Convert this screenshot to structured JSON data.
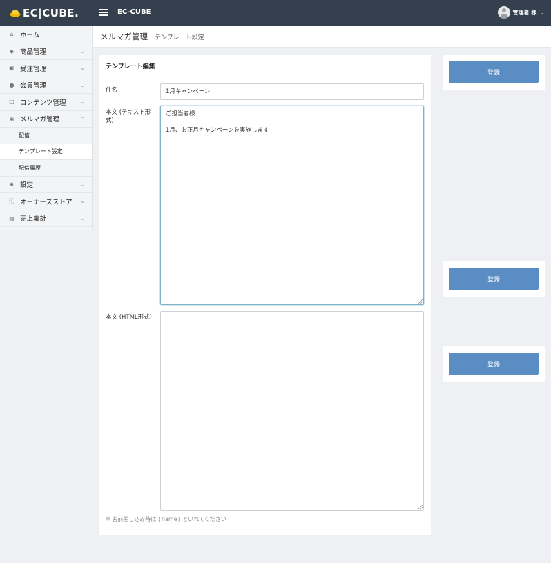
{
  "header": {
    "logo_text": "EC|CUBE.",
    "app_name": "EC-CUBE",
    "user_name": "管理者 様"
  },
  "sidebar": {
    "items": [
      {
        "label": "ホーム",
        "icon": "home-icon"
      },
      {
        "label": "商品管理",
        "icon": "tag-icon"
      },
      {
        "label": "受注管理",
        "icon": "cart-icon"
      },
      {
        "label": "会員管理",
        "icon": "users-icon"
      },
      {
        "label": "コンテンツ管理",
        "icon": "file-icon"
      },
      {
        "label": "メルマガ管理",
        "icon": "comment-icon"
      }
    ],
    "subitems": [
      {
        "label": "配信"
      },
      {
        "label": "テンプレート設定"
      },
      {
        "label": "配信履歴"
      }
    ],
    "items_after": [
      {
        "label": "設定",
        "icon": "gear-icon"
      },
      {
        "label": "オーナーズストア",
        "icon": "info-icon"
      },
      {
        "label": "売上集計",
        "icon": "chart-icon"
      }
    ]
  },
  "title_bar": {
    "title": "メルマガ管理",
    "subtitle": "テンプレート設定"
  },
  "form": {
    "heading": "テンプレート編集",
    "subject_label": "件名",
    "subject_value": "1月キャンペーン",
    "text_body_label": "本文 (テキスト形式)",
    "text_body_lines": [
      "ご担当者様",
      "",
      "1月、お正月キャンペーンを実施します"
    ],
    "html_body_label": "本文 (HTML形式)",
    "html_body_value": "",
    "note": "※ 名前差し込み時は {name} といれてください"
  },
  "actions": {
    "register_label": "登録"
  },
  "colors": {
    "header_bg": "#34404d",
    "button": "#5b8dc5",
    "logo_accent": "#f5b800"
  }
}
